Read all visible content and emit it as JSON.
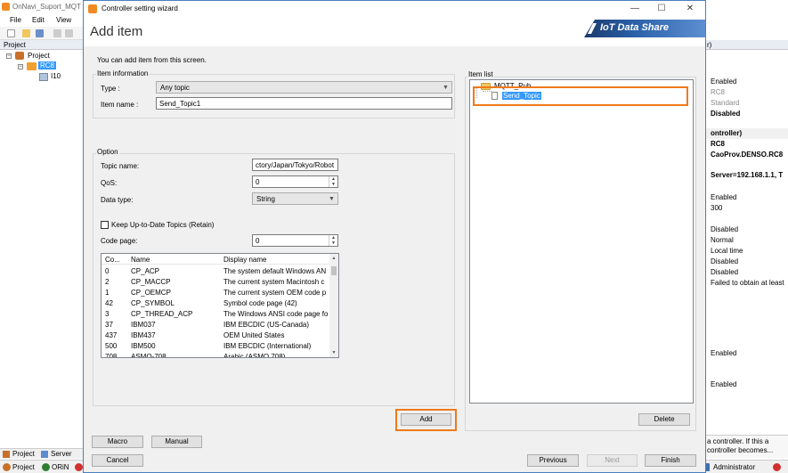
{
  "app": {
    "title": "OnNavi_Suport_MQT",
    "menu": [
      "File",
      "Edit",
      "View"
    ],
    "project_panel_title": "Project",
    "tree": {
      "root": "Project",
      "controller": "RC8",
      "child": "I10"
    },
    "bottom_tabs": [
      "Project",
      "Server"
    ],
    "status_items": [
      "Project",
      "ORiN"
    ],
    "status_right": "Administrator"
  },
  "properties": {
    "header": "r)",
    "rows": [
      {
        "text": "Enabled",
        "style": ""
      },
      {
        "text": "RC8",
        "style": "gray"
      },
      {
        "text": "Standard",
        "style": "gray"
      },
      {
        "text": "Disabled",
        "style": "bold"
      },
      {
        "text": "ontroller)",
        "style": "cat bold"
      },
      {
        "text": "RC8",
        "style": "bold"
      },
      {
        "text": "CaoProv.DENSO.RC8",
        "style": "bold"
      },
      {
        "text": "Server=192.168.1.1, T",
        "style": "bold"
      },
      {
        "text": "Enabled",
        "style": ""
      },
      {
        "text": "300",
        "style": ""
      },
      {
        "text": "Disabled",
        "style": ""
      },
      {
        "text": "Normal",
        "style": ""
      },
      {
        "text": "Local time",
        "style": ""
      },
      {
        "text": "Disabled",
        "style": ""
      },
      {
        "text": "Disabled",
        "style": ""
      },
      {
        "text": "Failed to obtain at least",
        "style": ""
      },
      {
        "text": "Enabled",
        "style": ""
      },
      {
        "text": "Enabled",
        "style": ""
      }
    ],
    "description": "a controller. If this a controller becomes..."
  },
  "dialog": {
    "title": "Controller setting wizard",
    "heading": "Add item",
    "banner": "IoT Data Share",
    "hint": "You can add item from this screen.",
    "item_info": {
      "group_label": "Item information",
      "type_label": "Type :",
      "type_value": "Any topic",
      "name_label": "Item name :",
      "name_value": "Send_Topic1"
    },
    "option": {
      "group_label": "Option",
      "topic_label": "Topic name:",
      "topic_value": "ctory/Japan/Tokyo/Robot",
      "qos_label": "QoS:",
      "qos_value": "0",
      "datatype_label": "Data type:",
      "datatype_value": "String",
      "retain_label": "Keep Up-to-Date Topics (Retain)",
      "codepage_label": "Code page:",
      "codepage_value": "0",
      "columns": [
        "Co...",
        "Name",
        "Display name"
      ],
      "rows": [
        [
          "0",
          "CP_ACP",
          "The system default Windows AN"
        ],
        [
          "2",
          "CP_MACCP",
          "The current system Macintosh c"
        ],
        [
          "1",
          "CP_OEMCP",
          "The current system OEM code p"
        ],
        [
          "42",
          "CP_SYMBOL",
          "Symbol code page (42)"
        ],
        [
          "3",
          "CP_THREAD_ACP",
          "The Windows ANSI code page fo"
        ],
        [
          "37",
          "IBM037",
          "IBM EBCDIC (US-Canada)"
        ],
        [
          "437",
          "IBM437",
          "OEM United States"
        ],
        [
          "500",
          "IBM500",
          "IBM EBCDIC (International)"
        ],
        [
          "708",
          "ASMO-708",
          "Arabic (ASMO 708)"
        ]
      ]
    },
    "add_button": "Add",
    "item_list": {
      "group_label": "Item list",
      "folder": "MQTT_Pub",
      "item": "Send_Topic",
      "delete_button": "Delete"
    },
    "buttons": {
      "macro": "Macro",
      "manual": "Manual",
      "cancel": "Cancel",
      "previous": "Previous",
      "next": "Next",
      "finish": "Finish"
    }
  }
}
